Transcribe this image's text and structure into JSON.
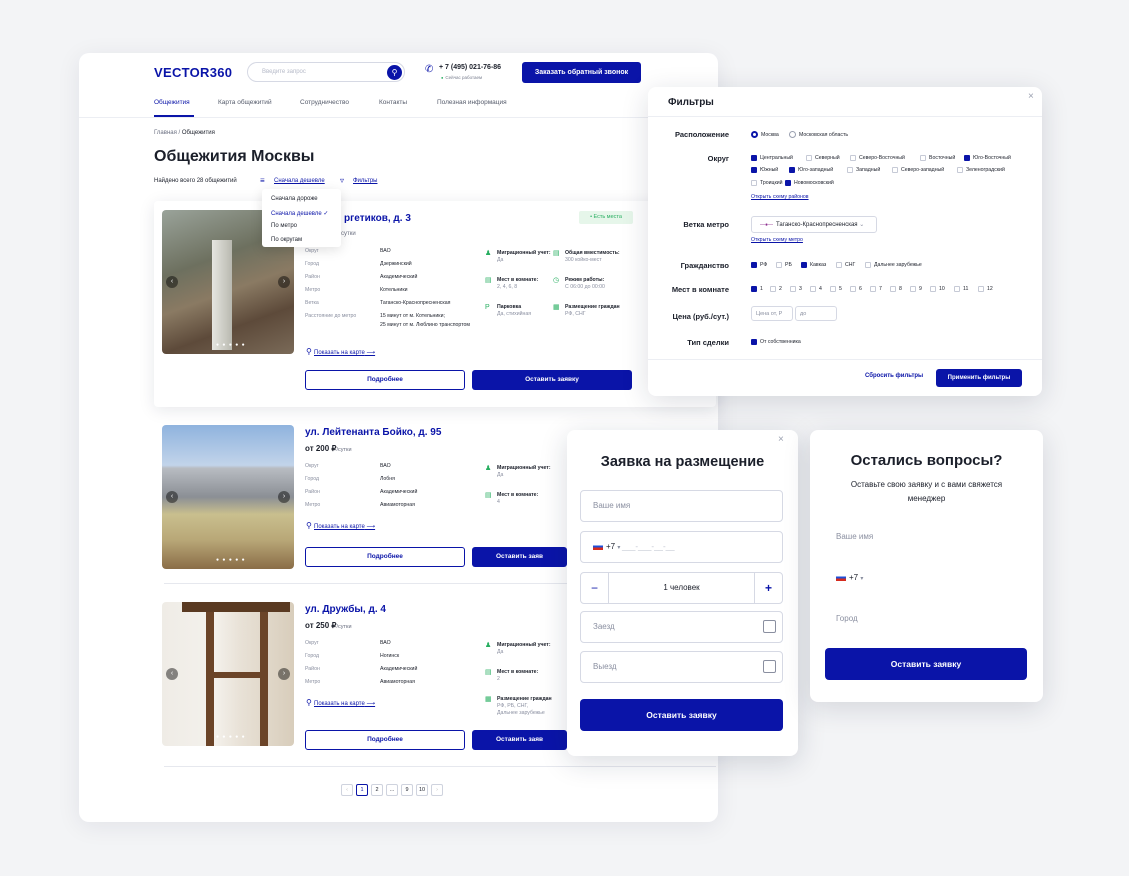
{
  "header": {
    "logo": "VECTOR360",
    "search_placeholder": "Введите запрос",
    "phone": "+ 7 (495) 021-76-86",
    "phone_status": "Сейчас работаем",
    "callback_button": "Заказать обратный звонок"
  },
  "nav": [
    "Общежития",
    "Карта общежитий",
    "Сотрудничество",
    "Контакты",
    "Полезная информация"
  ],
  "breadcrumb": {
    "home": "Главная",
    "sep": " / ",
    "current": "Общежития"
  },
  "page_title": "Общежития Москвы",
  "found_text": "Найдено всего 28 общежитий",
  "sort_label": "Сначала дешевле",
  "filters_link": "Фильтры",
  "sort_options": [
    "Сначала дороже",
    "Сначала дешевле",
    "По метро",
    "По округам"
  ],
  "listings": [
    {
      "title": "ул. Энергетиков, д. 3",
      "title_visible": "ргетиков, д. 3",
      "price_suffix": "сутки",
      "badge": "• Есть места",
      "fields": [
        {
          "k": "Округ",
          "v": "ВАО"
        },
        {
          "k": "Город",
          "v": "Дзержинский"
        },
        {
          "k": "Район",
          "v": "Академический"
        },
        {
          "k": "Метро",
          "v": "Котельники"
        },
        {
          "k": "Ветка",
          "v": "Таганско-Краснопресненская"
        },
        {
          "k": "Расстояние до метро",
          "v": "15 минут от м. Котельники;"
        },
        {
          "k": "",
          "v": "25 минут от м. Люблино транспортом"
        }
      ],
      "features": [
        {
          "t": "Миграционный учет:",
          "v": "Да"
        },
        {
          "t": "Общая вместимость:",
          "v": "300 койко-мест"
        },
        {
          "t": "Мест в комнате:",
          "v": "2, 4, 6, 8"
        },
        {
          "t": "Режим работы:",
          "v": "С 06:00 до 00:00"
        },
        {
          "t": "Парковка",
          "v": "Да, стихийная"
        },
        {
          "t": "Размещение граждан",
          "v": "РФ, СНГ"
        }
      ],
      "map_link": "Показать на карте",
      "details_button": "Подробнее",
      "apply_button": "Оставить заявку"
    },
    {
      "title": "ул. Лейтенанта Бойко, д. 95",
      "price": "от 200 ₽",
      "price_suffix": "/сутки",
      "fields": [
        {
          "k": "Округ",
          "v": "ВАО"
        },
        {
          "k": "Город",
          "v": "Лобня"
        },
        {
          "k": "Район",
          "v": "Академический"
        },
        {
          "k": "Метро",
          "v": "Авиамоторная"
        }
      ],
      "features": [
        {
          "t": "Миграционный учет:",
          "v": "Да"
        },
        {
          "t": "Мест в комнате:",
          "v": "4"
        }
      ],
      "map_link": "Показать на карте",
      "details_button": "Подробнее",
      "apply_button": "Оставить заяв"
    },
    {
      "title": "ул. Дружбы, д. 4",
      "price": "от 250 ₽",
      "price_suffix": "/сутки",
      "fields": [
        {
          "k": "Округ",
          "v": "ВАО"
        },
        {
          "k": "Город",
          "v": "Ногинск"
        },
        {
          "k": "Район",
          "v": "Академический"
        },
        {
          "k": "Метро",
          "v": "Авиамоторная"
        }
      ],
      "features": [
        {
          "t": "Миграционный учет:",
          "v": "Да"
        },
        {
          "t": "Мест в комнате:",
          "v": "2"
        },
        {
          "t": "Размещение граждан",
          "v": "РФ, РБ, СНГ,"
        },
        {
          "t": "",
          "v": "Дальнее зарубежье"
        }
      ],
      "map_link": "Показать на карте",
      "details_button": "Подробнее",
      "apply_button": "Оставить заяв"
    }
  ],
  "pagination": [
    "‹",
    "1",
    "2",
    "...",
    "9",
    "10",
    "›"
  ],
  "filters": {
    "title": "Фильтры",
    "location_label": "Расположение",
    "location_options": [
      {
        "l": "Москва",
        "on": true
      },
      {
        "l": "Московская область",
        "on": false
      }
    ],
    "district_label": "Округ",
    "districts": [
      {
        "l": "Центральный",
        "on": true
      },
      {
        "l": "Северный",
        "on": false
      },
      {
        "l": "Северо-Восточный",
        "on": false
      },
      {
        "l": "Восточный",
        "on": false
      },
      {
        "l": "Юго-Восточный",
        "on": true
      },
      {
        "l": "Южный",
        "on": true
      },
      {
        "l": "Юго-западный",
        "on": true
      },
      {
        "l": "Западный",
        "on": false
      },
      {
        "l": "Северо-западный",
        "on": false
      },
      {
        "l": "Зеленоградский",
        "on": false
      },
      {
        "l": "Троицкий",
        "on": false
      },
      {
        "l": "Новомосковский",
        "on": true
      }
    ],
    "districts_map_link": "Открыть схему районов",
    "metro_label": "Ветка метро",
    "metro_value": "Таганско-Краснопресненская",
    "metro_map_link": "Открыть схему метро",
    "citizenship_label": "Гражданство",
    "citizenship": [
      {
        "l": "РФ",
        "on": true
      },
      {
        "l": "РБ",
        "on": false
      },
      {
        "l": "Кавказ",
        "on": true
      },
      {
        "l": "СНГ",
        "on": false
      },
      {
        "l": "Дальнее зарубежье",
        "on": false
      }
    ],
    "rooms_label": "Мест в комнате",
    "rooms": [
      {
        "l": "1",
        "on": true
      },
      {
        "l": "2",
        "on": false
      },
      {
        "l": "3",
        "on": false
      },
      {
        "l": "4",
        "on": false
      },
      {
        "l": "5",
        "on": false
      },
      {
        "l": "6",
        "on": false
      },
      {
        "l": "7",
        "on": false
      },
      {
        "l": "8",
        "on": false
      },
      {
        "l": "9",
        "on": false
      },
      {
        "l": "10",
        "on": false
      },
      {
        "l": "11",
        "on": false
      },
      {
        "l": "12",
        "on": false
      }
    ],
    "price_label": "Цена (руб./сут.)",
    "price_from_placeholder": "Цена от, Р",
    "price_to_placeholder": "до",
    "deal_label": "Тип сделки",
    "deal_option": "От собственника",
    "reset": "Сбросить фильтры",
    "apply": "Применить фильтры"
  },
  "apply_form": {
    "title": "Заявка на размещение",
    "name_placeholder": "Ваше имя",
    "phone_prefix": "+7",
    "people": "1 человек",
    "checkin_placeholder": "Заезд",
    "checkout_placeholder": "Выезд",
    "submit": "Оставить заявку"
  },
  "questions": {
    "title": "Остались вопросы?",
    "subtitle": "Оставьте свою заявку и с вами свяжется менеджер",
    "name_placeholder": "Ваше имя",
    "phone_prefix": "+7",
    "city_placeholder": "Город",
    "submit": "Оставить заявку"
  },
  "colors": {
    "accent": "#0a14a8",
    "success": "#27ae60",
    "metro_line": "#8c2c8e"
  }
}
